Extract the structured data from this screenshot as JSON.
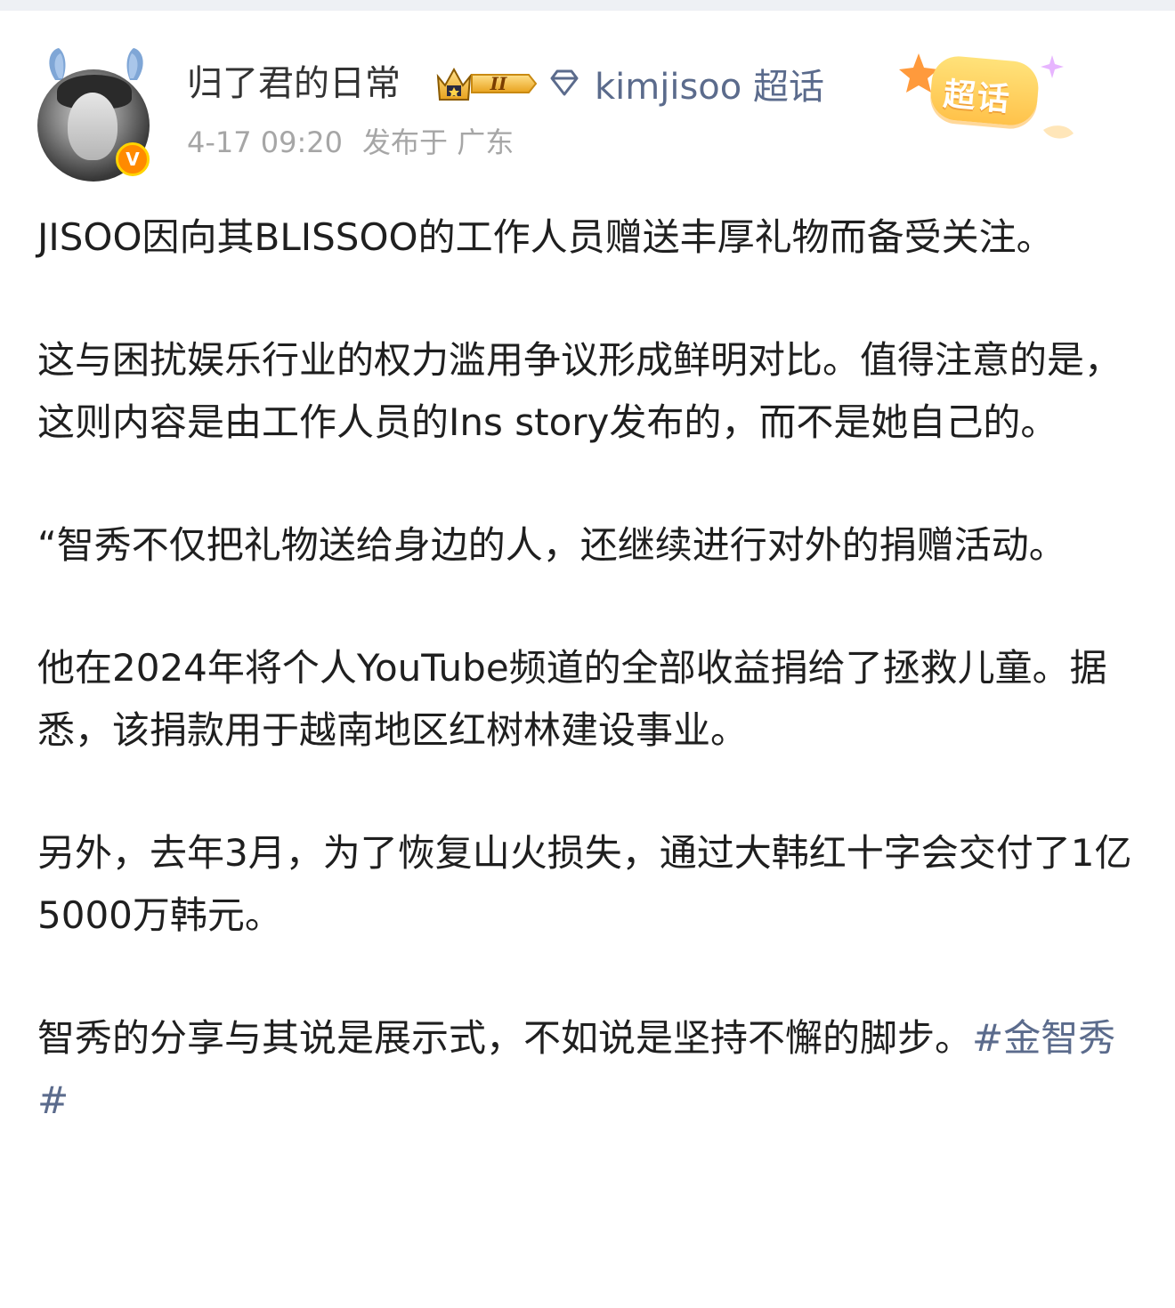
{
  "post": {
    "author": {
      "name": "归了君的日常",
      "level_badge": "II",
      "verified_mark": "V",
      "avatar_icon": "avatar-photo"
    },
    "topic": {
      "label": "kimjisoo 超话",
      "icon": "diamond-icon"
    },
    "meta": {
      "time": "4-17 09:20",
      "location": "发布于 广东"
    },
    "sticker": {
      "label": "超话"
    },
    "paragraphs": [
      "JISOO因向其BLISSOO的工作人员赠送丰厚礼物而备受关注。",
      "这与困扰娱乐行业的权力滥用争议形成鲜明对比。值得注意的是，这则内容是由工作人员的Ins story发布的，而不是她自己的。",
      "“智秀不仅把礼物送给身边的人，还继续进行对外的捐赠活动。",
      "他在2024年将个人YouTube频道的全部收益捐给了拯救儿童。据悉，该捐款用于越南地区红树林建设事业。",
      "另外，去年3月，为了恢复山火损失，通过大韩红十字会交付了1亿5000万韩元。"
    ],
    "last_paragraph_text": "智秀的分享与其说是展示式，不如说是坚持不懈的脚步。",
    "hashtag": "#金智秀#"
  },
  "colors": {
    "link": "#5b6b8c",
    "meta": "#a6a6a6",
    "text": "#1f1f1f",
    "verified": "#ff8a00",
    "sticker": "#ffc24a"
  }
}
